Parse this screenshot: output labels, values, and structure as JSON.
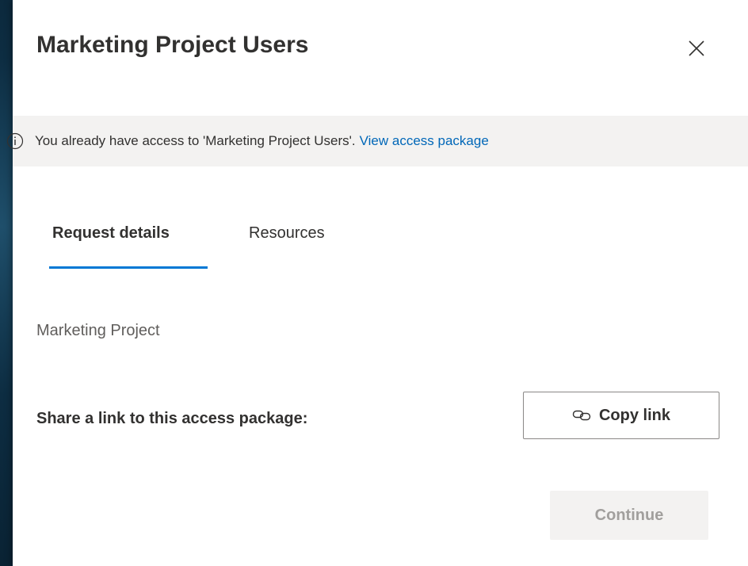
{
  "dialog": {
    "title": "Marketing Project Users",
    "close_icon": "close-icon"
  },
  "banner": {
    "icon": "info-icon",
    "message": "You already have access to 'Marketing Project Users'.",
    "link_label": "View access package"
  },
  "tabs": [
    {
      "label": "Request details",
      "selected": true
    },
    {
      "label": "Resources",
      "selected": false
    }
  ],
  "description": "Marketing Project",
  "share": {
    "label": "Share a link to this access package:",
    "copy_button_label": "Copy link",
    "copy_icon": "link-icon"
  },
  "footer": {
    "continue_label": "Continue",
    "continue_disabled": true
  },
  "colors": {
    "accent": "#0078d4",
    "link": "#0067b8",
    "banner_bg": "#f3f2f1",
    "text": "#323130"
  }
}
